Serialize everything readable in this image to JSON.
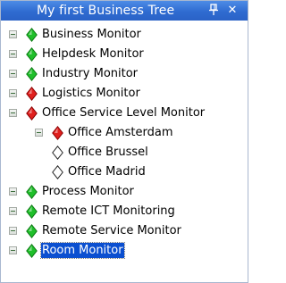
{
  "panel": {
    "title": "My first Business Tree",
    "pin_icon": "pin-icon",
    "close_icon": "close-icon"
  },
  "colors": {
    "title_bar": "#2f6bd1",
    "status_green": "#1fbf2a",
    "status_red": "#e0201e",
    "status_none": "#ffffff",
    "selection": "#0b4fd0"
  },
  "tree": [
    {
      "label": "Business Monitor",
      "status": "green",
      "depth": 0,
      "expander": "collapsed"
    },
    {
      "label": "Helpdesk Monitor",
      "status": "green",
      "depth": 0,
      "expander": "collapsed"
    },
    {
      "label": "Industry Monitor",
      "status": "green",
      "depth": 0,
      "expander": "collapsed"
    },
    {
      "label": "Logistics Monitor",
      "status": "red",
      "depth": 0,
      "expander": "collapsed"
    },
    {
      "label": "Office Service Level Monitor",
      "status": "red",
      "depth": 0,
      "expander": "expanded"
    },
    {
      "label": "Office Amsterdam",
      "status": "red",
      "depth": 1,
      "expander": "collapsed"
    },
    {
      "label": "Office Brussel",
      "status": "none",
      "depth": 1,
      "expander": "none"
    },
    {
      "label": "Office Madrid",
      "status": "none",
      "depth": 1,
      "expander": "none"
    },
    {
      "label": "Process Monitor",
      "status": "green",
      "depth": 0,
      "expander": "collapsed"
    },
    {
      "label": "Remote ICT Monitoring",
      "status": "green",
      "depth": 0,
      "expander": "collapsed"
    },
    {
      "label": "Remote Service Monitor",
      "status": "green",
      "depth": 0,
      "expander": "collapsed"
    },
    {
      "label": "Room Monitor",
      "status": "green",
      "depth": 0,
      "expander": "collapsed",
      "selected": true
    }
  ]
}
